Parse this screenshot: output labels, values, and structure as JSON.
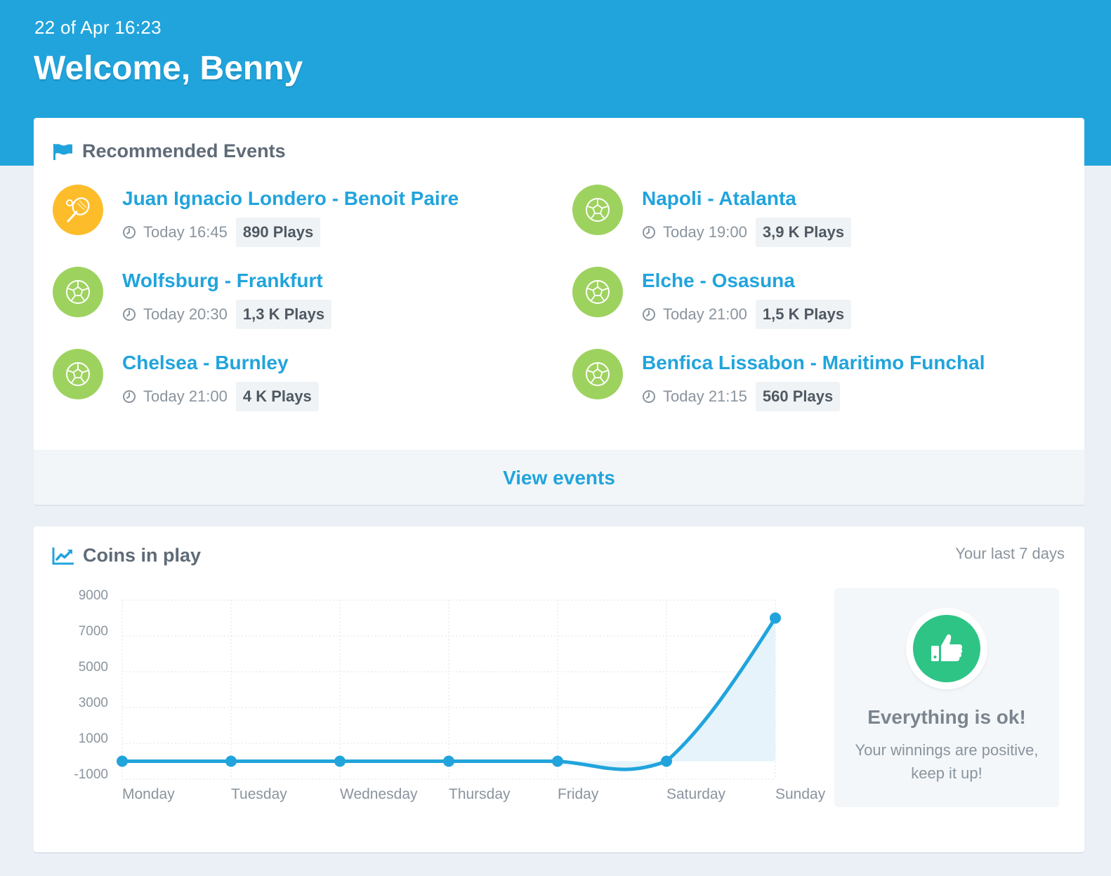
{
  "header": {
    "date": "22 of Apr 16:23",
    "title": "Welcome, Benny"
  },
  "events_card": {
    "title": "Recommended Events",
    "icon": "flag-icon",
    "footer_link": "View events",
    "events": [
      {
        "sport": "tennis",
        "icon": "tennis-icon",
        "title": "Juan Ignacio Londero - Benoit Paire",
        "time": "Today 16:45",
        "plays": "890 Plays"
      },
      {
        "sport": "soccer",
        "icon": "soccer-ball-icon",
        "title": "Napoli - Atalanta",
        "time": "Today 19:00",
        "plays": "3,9 K Plays"
      },
      {
        "sport": "soccer",
        "icon": "soccer-ball-icon",
        "title": "Wolfsburg - Frankfurt",
        "time": "Today 20:30",
        "plays": "1,3 K Plays"
      },
      {
        "sport": "soccer",
        "icon": "soccer-ball-icon",
        "title": "Elche - Osasuna",
        "time": "Today 21:00",
        "plays": "1,5 K Plays"
      },
      {
        "sport": "soccer",
        "icon": "soccer-ball-icon",
        "title": "Chelsea - Burnley",
        "time": "Today 21:00",
        "plays": "4 K Plays"
      },
      {
        "sport": "soccer",
        "icon": "soccer-ball-icon",
        "title": "Benfica Lissabon - Maritimo Funchal",
        "time": "Today 21:15",
        "plays": "560 Plays"
      }
    ]
  },
  "coins_card": {
    "title": "Coins in play",
    "icon": "line-chart-icon",
    "range_label": "Your last 7 days",
    "status": {
      "icon": "thumbs-up-icon",
      "title": "Everything is ok!",
      "message": "Your winnings are positive, keep it up!"
    }
  },
  "colors": {
    "primary": "#21a4dc",
    "tennis": "#fdbd2b",
    "soccer": "#9ed25f",
    "success": "#2ec486",
    "background": "#ebf0f6"
  },
  "chart_data": {
    "type": "line",
    "categories": [
      "Monday",
      "Tuesday",
      "Wednesday",
      "Thursday",
      "Friday",
      "Saturday",
      "Sunday"
    ],
    "series": [
      {
        "values": [
          0,
          0,
          0,
          0,
          0,
          0,
          8000
        ]
      }
    ],
    "yticks": [
      9000,
      7000,
      5000,
      3000,
      1000,
      -1000
    ],
    "ylim": [
      -1000,
      9000
    ],
    "grid": true,
    "title": "",
    "xlabel": "",
    "ylabel": ""
  }
}
